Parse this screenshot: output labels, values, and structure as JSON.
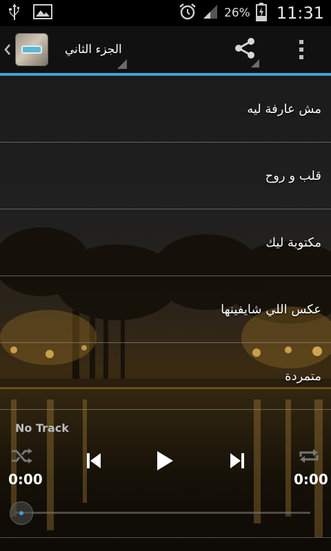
{
  "status_bar": {
    "battery_percent": "26%",
    "time": "11:31",
    "icons": [
      "usb-icon",
      "image-icon",
      "alarm-icon",
      "signal-icon",
      "battery-charging-icon"
    ]
  },
  "action_bar": {
    "title": "الجزء الثاني",
    "accent_color": "#3fa4d6"
  },
  "playlist": {
    "tracks": [
      {
        "title": "مش عارفة ليه"
      },
      {
        "title": "قلب و روح"
      },
      {
        "title": "مكتوبة ليك"
      },
      {
        "title": "عكس اللي شايفينها"
      },
      {
        "title": "متمردة"
      }
    ]
  },
  "player": {
    "now_playing": "No Track",
    "elapsed": "0:00",
    "duration": "0:00",
    "progress": 0
  }
}
